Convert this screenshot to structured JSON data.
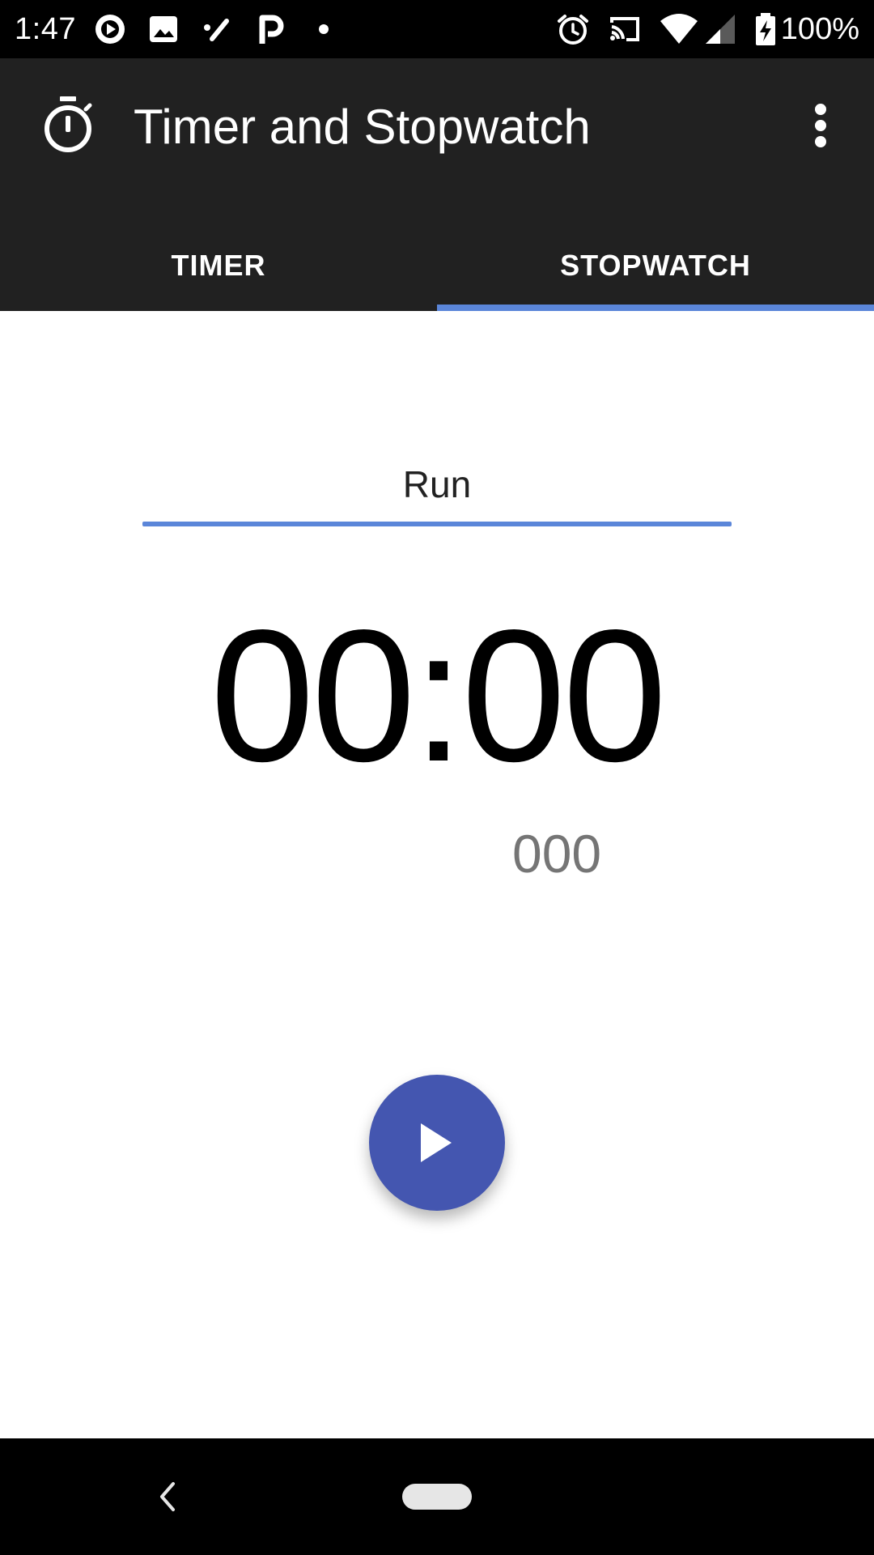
{
  "status_bar": {
    "time": "1:47",
    "battery_percent": "100%",
    "left_icons": [
      "play-circle-icon",
      "image-icon",
      "pen-icon",
      "parking-icon",
      "dot-icon"
    ],
    "right_icons": [
      "alarm-icon",
      "cast-icon",
      "wifi-icon",
      "signal-icon",
      "battery-charging-icon"
    ]
  },
  "app_bar": {
    "title": "Timer and Stopwatch",
    "icon": "stopwatch-icon",
    "background_color": "#212121"
  },
  "tabs": [
    {
      "label": "TIMER",
      "selected": false
    },
    {
      "label": "STOPWATCH",
      "selected": true
    }
  ],
  "stopwatch": {
    "label": "Run",
    "time": "00:00",
    "milliseconds": "000"
  },
  "fab": {
    "icon": "play-icon",
    "color": "#4456B0"
  },
  "accent_color": "#5B86D9",
  "nav_bar": {
    "icons": [
      "back-icon",
      "home-pill-icon"
    ]
  }
}
